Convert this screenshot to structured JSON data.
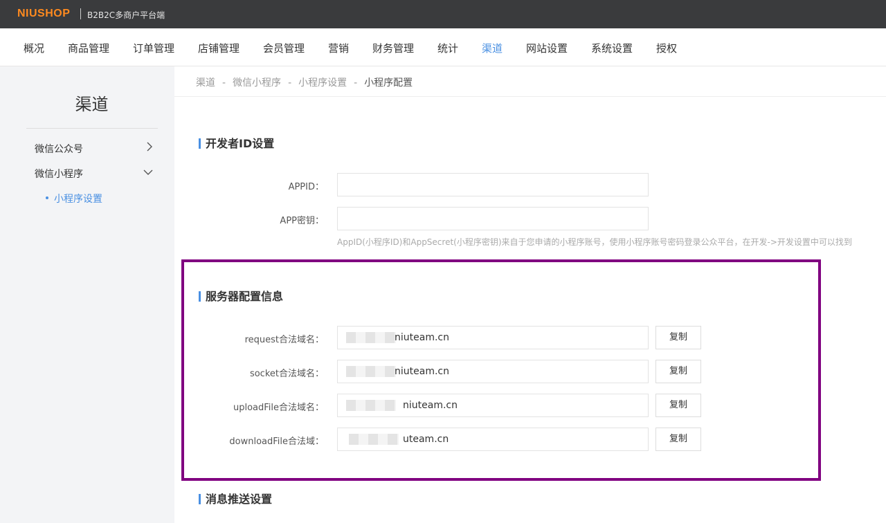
{
  "brand": {
    "logo_text": "NIUSHOP",
    "subtitle": "B2B2C多商户平台端"
  },
  "nav": {
    "items": [
      "概况",
      "商品管理",
      "订单管理",
      "店铺管理",
      "会员管理",
      "营销",
      "财务管理",
      "统计",
      "渠道",
      "网站设置",
      "系统设置",
      "授权"
    ],
    "active": "渠道"
  },
  "sidebar": {
    "title": "渠道",
    "items": [
      {
        "label": "微信公众号",
        "icon": "chevron-right-icon"
      },
      {
        "label": "微信小程序",
        "icon": "chevron-down-icon"
      }
    ],
    "sub_items": [
      {
        "label": "小程序设置"
      }
    ]
  },
  "breadcrumb": {
    "items": [
      "渠道",
      "微信小程序",
      "小程序设置",
      "小程序配置"
    ],
    "separator": "-"
  },
  "developer_section": {
    "title": "开发者ID设置",
    "appid_label": "APPID：",
    "appid_value": "",
    "secret_label": "APP密钥：",
    "secret_value": "",
    "hint": "AppID(小程序ID)和AppSecret(小程序密钥)来自于您申请的小程序账号，使用小程序账号密码登录公众平台，在开发->开发设置中可以找到"
  },
  "server_section": {
    "title": "服务器配置信息",
    "fields": [
      {
        "label": "request合法域名：",
        "value": "niuteam.cn",
        "button": "复制"
      },
      {
        "label": "socket合法域名：",
        "value": "niuteam.cn",
        "button": "复制"
      },
      {
        "label": "uploadFile合法域名：",
        "value": "niuteam.cn",
        "button": "复制"
      },
      {
        "label": "downloadFile合法域：",
        "value": "uteam.cn",
        "button": "复制"
      }
    ]
  },
  "message_section": {
    "title": "消息推送设置"
  },
  "colors": {
    "accent": "#4a90e2",
    "topbar": "#3a3b3d",
    "logo": "#ff8a1f",
    "highlight": "#800080"
  }
}
